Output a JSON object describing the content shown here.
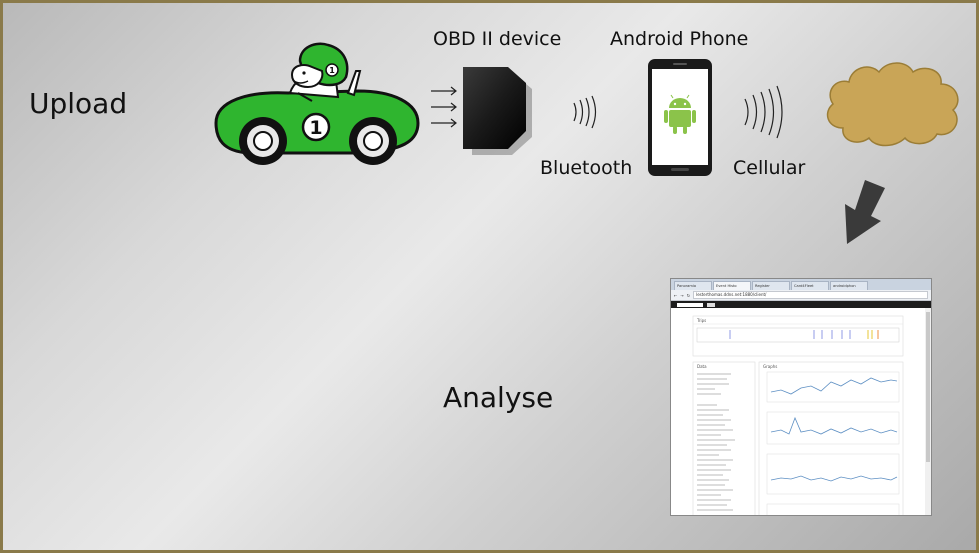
{
  "labels": {
    "upload": "Upload",
    "analyse": "Analyse",
    "obd": "OBD II device",
    "phone": "Android Phone",
    "bluetooth": "Bluetooth",
    "cellular": "Cellular"
  },
  "car": {
    "number": "1",
    "color": "#2fb52f"
  },
  "browser": {
    "tabs": [
      "Panoramio",
      "Event Histo",
      "Register",
      "Card4Fleet",
      "androidphon"
    ],
    "url": "lesterthomas.ddns.net:1880/client/",
    "sections": [
      "Trips",
      "Data",
      "Graphs"
    ]
  },
  "colors": {
    "cloud": "#c9a557",
    "arrow": "#3a3a3a",
    "android": "#8bc34a"
  }
}
